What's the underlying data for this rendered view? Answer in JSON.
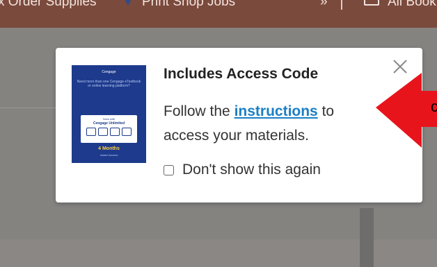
{
  "browser": {
    "bookmarks": [
      {
        "label": "x Order Supplies"
      },
      {
        "label": "Print Shop Jobs"
      },
      {
        "label": "All Bookmarks"
      }
    ],
    "overflow_label": "»"
  },
  "popup": {
    "title": "Includes Access Code",
    "body_prefix": "Follow the",
    "link_label": "instructions",
    "body_suffix_1": "to",
    "body_suffix_2": "access your materials.",
    "checkbox_label": "Don't show this again",
    "checkbox_checked": false,
    "close_label": "×",
    "promo": {
      "brand": "Cengage",
      "question": "Need more than one Cengage eTextbook or online learning platform?",
      "save_text": "Save with",
      "product": "Cengage Unlimited",
      "months": "4 Months",
      "months_sub": "Instant Access"
    }
  },
  "annotation": {
    "arrow_color": "#e8141c",
    "arrow_text": "c"
  },
  "colors": {
    "bookmark_bar": "#7a4a3d",
    "link": "#1a7fc4",
    "promo_bg": "#1d3a8c"
  }
}
